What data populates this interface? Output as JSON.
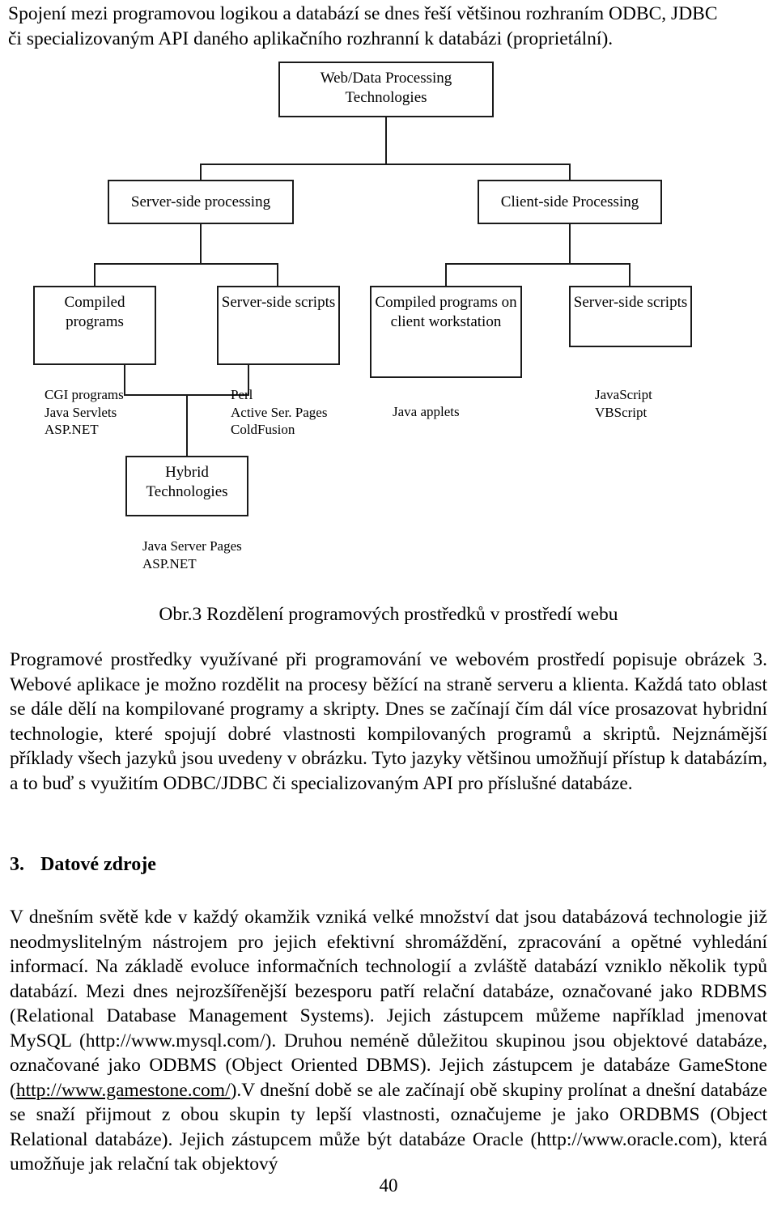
{
  "document": {
    "page_number": "40",
    "intro_paragraph": {
      "line1": "Spojení mezi programovou logikou a databází se dnes řeší většinou rozhraním ODBC, JDBC",
      "line2": "či specializovaným API daného aplikačního rozhranní k databázi (proprietální)."
    },
    "figure": {
      "caption": "Obr.3 Rozdělení programových prostředků v prostředí webu",
      "nodes": {
        "root": "Web/Data Processing\nTechnologies",
        "server_side": "Server-side processing",
        "client_side": "Client-side Processing",
        "server_compiled": "Compiled\nprograms",
        "server_scripts": "Server-side\nscripts",
        "client_compiled": "Compiled\nprograms on\nclient workstation",
        "client_scripts": "Server-side\nscripts",
        "hybrid": "Hybrid\nTechnologies"
      },
      "leaf_labels": {
        "server_compiled_examples": "CGI programs\nJava Servlets\nASP.NET",
        "server_scripts_examples": "Perl\nActive Ser. Pages\nColdFusion",
        "client_compiled_examples": "Java applets",
        "client_scripts_examples": "JavaScript\nVBScript",
        "hybrid_examples": "Java Server Pages\nASP.NET"
      }
    },
    "paragraph_after_figure": "Programové prostředky využívané při programování ve webovém prostředí popisuje  obrázek 3. Webové aplikace je možno rozdělit na procesy běžící na straně serveru a klienta. Každá tato oblast se dále dělí na kompilované programy a skripty. Dnes se začínají čím dál více prosazovat hybridní technologie, které spojují dobré vlastnosti kompilovaných programů a skriptů. Nejznámější příklady všech jazyků jsou uvedeny  v obrázku. Tyto jazyky většinou umožňují přístup k databázím, a to buď s využitím ODBC/JDBC či specializovaným API pro příslušné databáze.",
    "section": {
      "number": "3.",
      "title": "Datové zdroje"
    },
    "section_paragraph": {
      "part1": "V dnešním světě kde v každý okamžik vzniká velké množství dat jsou databázová technologie již neodmyslitelným nástrojem pro jejich efektivní shromáždění, zpracování a opětné vyhledání informací. Na základě  evoluce informačních technologií a zvláště databází vzniklo několik typů databází. Mezi dnes nejrozšířenější bezesporu patří relační databáze, označované jako RDBMS (Relational Database Management Systems). Jejich zástupcem můžeme například jmenovat MySQL (http://www.mysql.com/). Druhou neméně důležitou skupinou jsou objektové databáze, označované jako ODBMS (Object Oriented DBMS). Jejich zástupcem je databáze GameStone (",
      "link_gamestone": "http://www.gamestone.com/",
      "part2": ").V dnešní době se ale začínají obě skupiny prolínat a dnešní databáze se snaží přijmout z obou skupin ty lepší vlastnosti, označujeme je jako ORDBMS (Object Relational databáze). Jejich zástupcem může být databáze Oracle (http://www.oracle.com), která umožňuje jak relační tak objektový"
    },
    "colors": {
      "text": "#000000",
      "box_border": "#1a1a1a",
      "background": "#ffffff"
    }
  }
}
